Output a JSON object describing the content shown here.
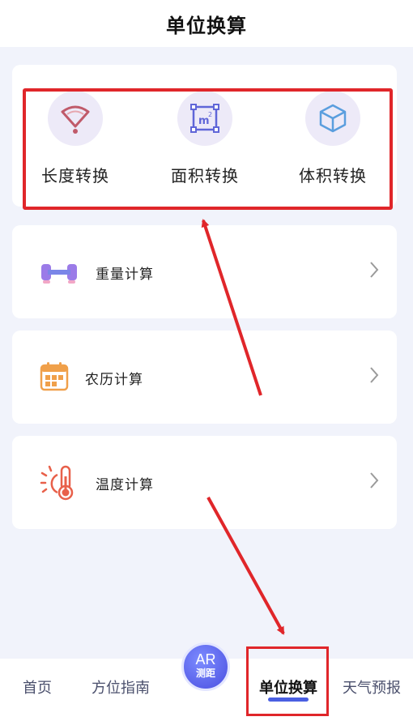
{
  "header": {
    "title": "单位换算"
  },
  "conversions": [
    {
      "label": "长度转换",
      "icon": "ruler-fan-icon",
      "color": "#c05a6a"
    },
    {
      "label": "面积转换",
      "icon": "area-square-icon",
      "color": "#6066d8"
    },
    {
      "label": "体积转换",
      "icon": "cube-icon",
      "color": "#5a9ede"
    }
  ],
  "calculators": [
    {
      "label": "重量计算",
      "icon": "dumbbell-icon"
    },
    {
      "label": "农历计算",
      "icon": "calendar-icon"
    },
    {
      "label": "温度计算",
      "icon": "thermometer-icon"
    }
  ],
  "bottom_nav": {
    "items": [
      "首页",
      "方位指南",
      "单位换算",
      "天气预报"
    ],
    "active": "单位换算",
    "ar_button": {
      "top": "AR",
      "sub": "测距"
    }
  },
  "colors": {
    "accent": "#4a5fe2",
    "highlight": "#e0262a"
  }
}
